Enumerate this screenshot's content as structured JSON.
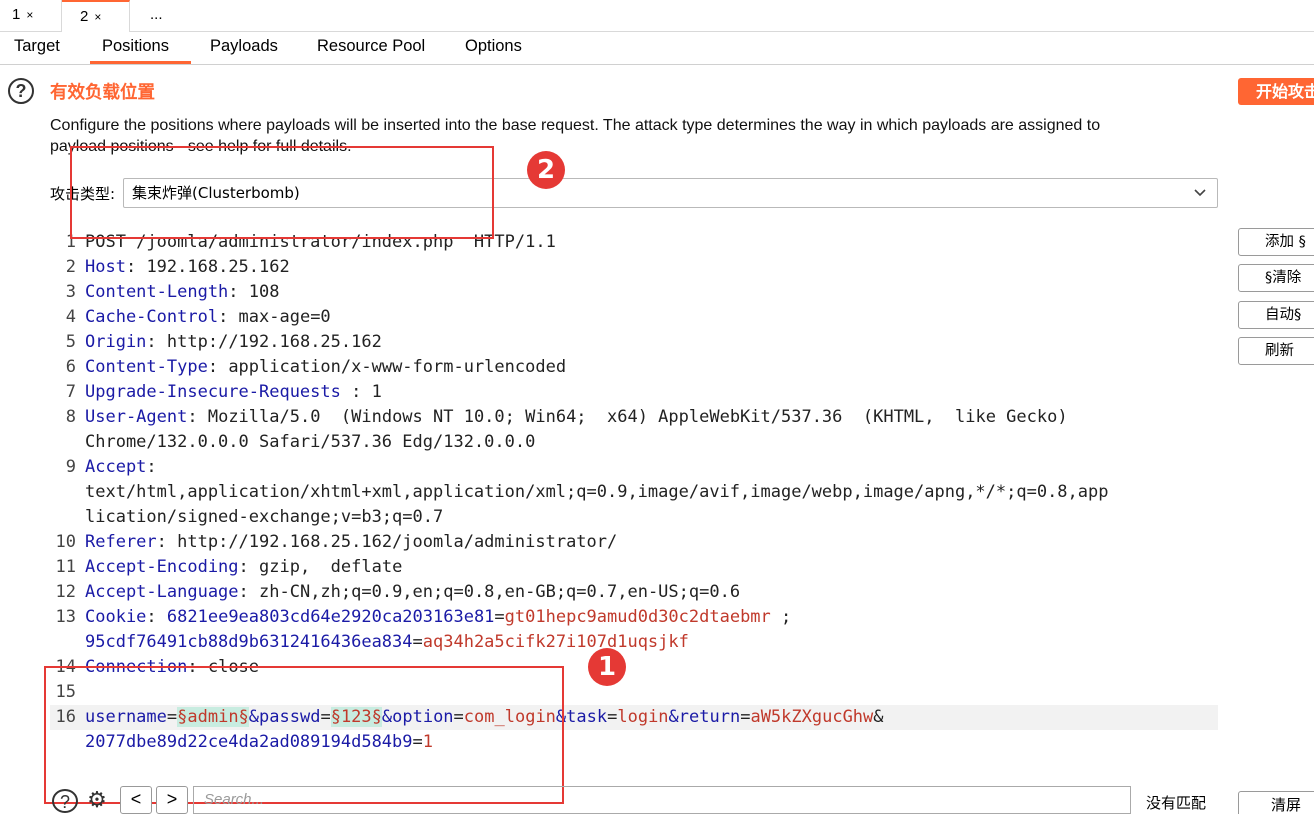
{
  "attack_tabs": [
    {
      "label": "1",
      "close": "×"
    },
    {
      "label": "2",
      "close": "×"
    },
    {
      "label": "..."
    }
  ],
  "sub_tabs": [
    "Target",
    "Positions",
    "Payloads",
    "Resource Pool",
    "Options"
  ],
  "active_sub_tab": "Positions",
  "header": {
    "help_icon": "?",
    "title": "有效负载位置",
    "start_button": "开始攻击",
    "description_line1": "Configure the positions where payloads will be inserted into the base request. The attack type determines the way in which payloads are assigned to",
    "description_line2": "payload positions - see help for full details."
  },
  "attack_type": {
    "label": "攻击类型:",
    "value": "集束炸弹(Clusterbomb)",
    "chevron_icon": "chevron-down-icon"
  },
  "side_buttons": [
    "添加 §",
    "§清除",
    "自动§",
    "刷新"
  ],
  "request_lines": [
    {
      "n": "1",
      "key": "",
      "sep": "",
      "val": "POST /joomla/administrator/index.php  HTTP/1.1"
    },
    {
      "n": "2",
      "key": "Host",
      "sep": ": ",
      "val": "192.168.25.162"
    },
    {
      "n": "3",
      "key": "Content-Length",
      "sep": ": ",
      "val": "108"
    },
    {
      "n": "4",
      "key": "Cache-Control",
      "sep": ": ",
      "val": "max-age=0"
    },
    {
      "n": "5",
      "key": "Origin",
      "sep": ": ",
      "val": "http://192.168.25.162"
    },
    {
      "n": "6",
      "key": "Content-Type",
      "sep": ": ",
      "val": "application/x-www-form-urlencoded"
    },
    {
      "n": "7",
      "key": "Upgrade-Insecure-Requests",
      "sep": " : ",
      "val": "1"
    },
    {
      "n": "8",
      "key": "User-Agent",
      "sep": ": ",
      "val": "Mozilla/5.0  (Windows NT 10.0; Win64;  x64) AppleWebKit/537.36  (KHTML,  like Gecko)"
    },
    {
      "n": "",
      "key": "",
      "sep": "",
      "val": "Chrome/132.0.0.0 Safari/537.36 Edg/132.0.0.0"
    },
    {
      "n": "9",
      "key": "Accept",
      "sep": ":",
      "val": ""
    },
    {
      "n": "",
      "key": "",
      "sep": "",
      "val": "text/html,application/xhtml+xml,application/xml;q=0.9,image/avif,image/webp,image/apng,*/*;q=0.8,app"
    },
    {
      "n": "",
      "key": "",
      "sep": "",
      "val": "lication/signed-exchange;v=b3;q=0.7"
    },
    {
      "n": "10",
      "key": "Referer",
      "sep": ": ",
      "val": "http://192.168.25.162/joomla/administrator/"
    },
    {
      "n": "11",
      "key": "Accept-Encoding",
      "sep": ": ",
      "val": "gzip,  deflate"
    },
    {
      "n": "12",
      "key": "Accept-Language",
      "sep": ": ",
      "val": "zh-CN,zh;q=0.9,en;q=0.8,en-GB;q=0.7,en-US;q=0.6"
    },
    {
      "n": "13",
      "key": "Cookie",
      "sep": ": ",
      "val": ""
    },
    {
      "n": "",
      "key": "",
      "sep": "",
      "val": ""
    },
    {
      "n": "14",
      "key": "Connection",
      "sep": ": ",
      "val": "close"
    },
    {
      "n": "15",
      "key": "",
      "sep": "",
      "val": ""
    },
    {
      "n": "16",
      "key": "",
      "sep": "",
      "val": ""
    },
    {
      "n": "",
      "key": "",
      "sep": "",
      "val": ""
    }
  ],
  "cookie": {
    "name1": "6821ee9ea803cd64e2920ca203163e81",
    "value1": "gt01hepc9amud0d30c2dtaebmr",
    "sep1": " ;",
    "name2": "95cdf76491cb88d9b6312416436ea834",
    "value2": "aq34h2a5cifk27i107d1uqsjkf"
  },
  "body": {
    "k_username": "username",
    "payload1": "§admin§",
    "k_passwd": "&passwd",
    "payload2": "§123§",
    "k_option": "&option",
    "v_option": "com_login",
    "k_task": "&task",
    "v_task": "login",
    "k_return": "&return",
    "v_return": "aW5kZXgucGhw",
    "amp": "&",
    "k_token": "2077dbe89d22ce4da2ad089194d584b9",
    "v_token": "1",
    "eq": "="
  },
  "annotations": [
    "1",
    "2"
  ],
  "bottom_bar": {
    "search_placeholder": "Search...",
    "no_match": "没有匹配",
    "clear_button": "清屏",
    "prev": "<",
    "next": ">",
    "help": "?",
    "gear": "⚙"
  },
  "colors": {
    "accent": "#ff6633",
    "annotation": "#e53935",
    "key": "#1a1aa6",
    "value_red": "#c0392b",
    "payload_bg": "#c8ece0"
  }
}
